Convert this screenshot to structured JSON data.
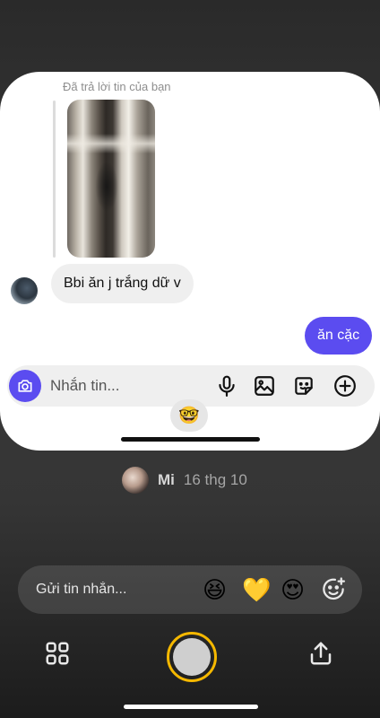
{
  "thread": {
    "reply_hint": "Đã trả lời tin của bạn",
    "incoming_message": "Bbi ăn j trắng dữ v",
    "outgoing_message": "ăn cặc",
    "composer_placeholder": "Nhắn tin...",
    "reaction_peek": "🤓"
  },
  "story_meta": {
    "name": "Mi",
    "date": "16 thg 10"
  },
  "reply_bar": {
    "placeholder": "Gửi tin nhắn...",
    "reactions": [
      "😆",
      "💛",
      "😍"
    ]
  },
  "colors": {
    "accent": "#5b4cf0",
    "shutter_ring": "#f5b800"
  },
  "icons": [
    "camera-icon",
    "microphone-icon",
    "image-icon",
    "sticker-icon",
    "plus-circle-icon",
    "add-reaction-icon",
    "grid-icon",
    "share-icon"
  ]
}
